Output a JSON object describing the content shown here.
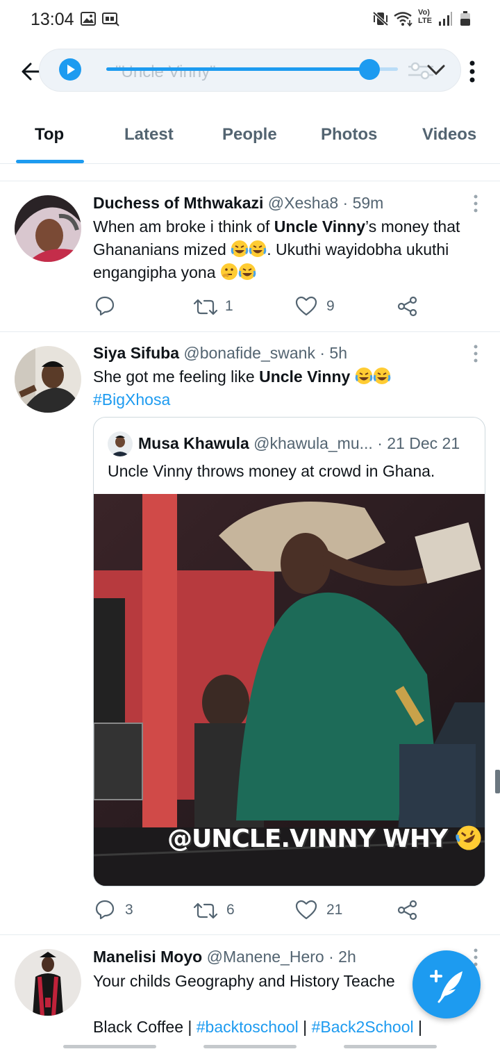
{
  "status_bar": {
    "time": "13:04",
    "left_icons": [
      "gallery-icon",
      "vr-icon"
    ],
    "right_icons": [
      "vibrate-mute-icon",
      "wifi-icon",
      "volte-icon",
      "signal-icon",
      "battery-icon"
    ],
    "volte_text_top": "Vo)",
    "volte_text_bottom": "LTE"
  },
  "search": {
    "query": "\"Uncle Vinny\"",
    "audio_progress": 0.92
  },
  "tabs": [
    {
      "label": "Top",
      "active": true
    },
    {
      "label": "Latest",
      "active": false
    },
    {
      "label": "People",
      "active": false
    },
    {
      "label": "Photos",
      "active": false
    },
    {
      "label": "Videos",
      "active": false
    }
  ],
  "tweets": [
    {
      "name": "Duchess of Mthwakazi",
      "handle": "@Xesha8",
      "time": "59m",
      "text_a": "When am broke i think of ",
      "text_hl": "Uncle Vinny",
      "text_b": "’s money that Ghananians mized ",
      "text_c": ". Ukuthi wayidobha ukuthi engangipha yona ",
      "replies": "",
      "retweets": "1",
      "likes": "9"
    },
    {
      "name": "Siya Sifuba",
      "handle": "@bonafide_swank",
      "time": "5h",
      "text_a": "She got me feeling like ",
      "text_hl": "Uncle Vinny",
      "hashtag": "#BigXhosa",
      "replies": "3",
      "retweets": "6",
      "likes": "21",
      "quote": {
        "name": "Musa Khawula",
        "handle": "@khawula_mu...",
        "time": "21 Dec 21",
        "text": "Uncle Vinny throws money at crowd in Ghana.",
        "media_caption": "@UNCLE.VINNY WHY"
      }
    },
    {
      "name": "Manelisi Moyo",
      "handle": "@Manene_Hero",
      "time": "2h",
      "line1": "Your childs Geography and History Teache",
      "line3_a": "Black Coffee | ",
      "tag1": "#backtoschool",
      "line3_b": " | ",
      "tag2": "#Back2School",
      "line3_c": " |"
    }
  ],
  "colors": {
    "accent": "#1d9bf0",
    "text": "#0f1419",
    "muted": "#536471",
    "divider": "#e6ecf0"
  }
}
